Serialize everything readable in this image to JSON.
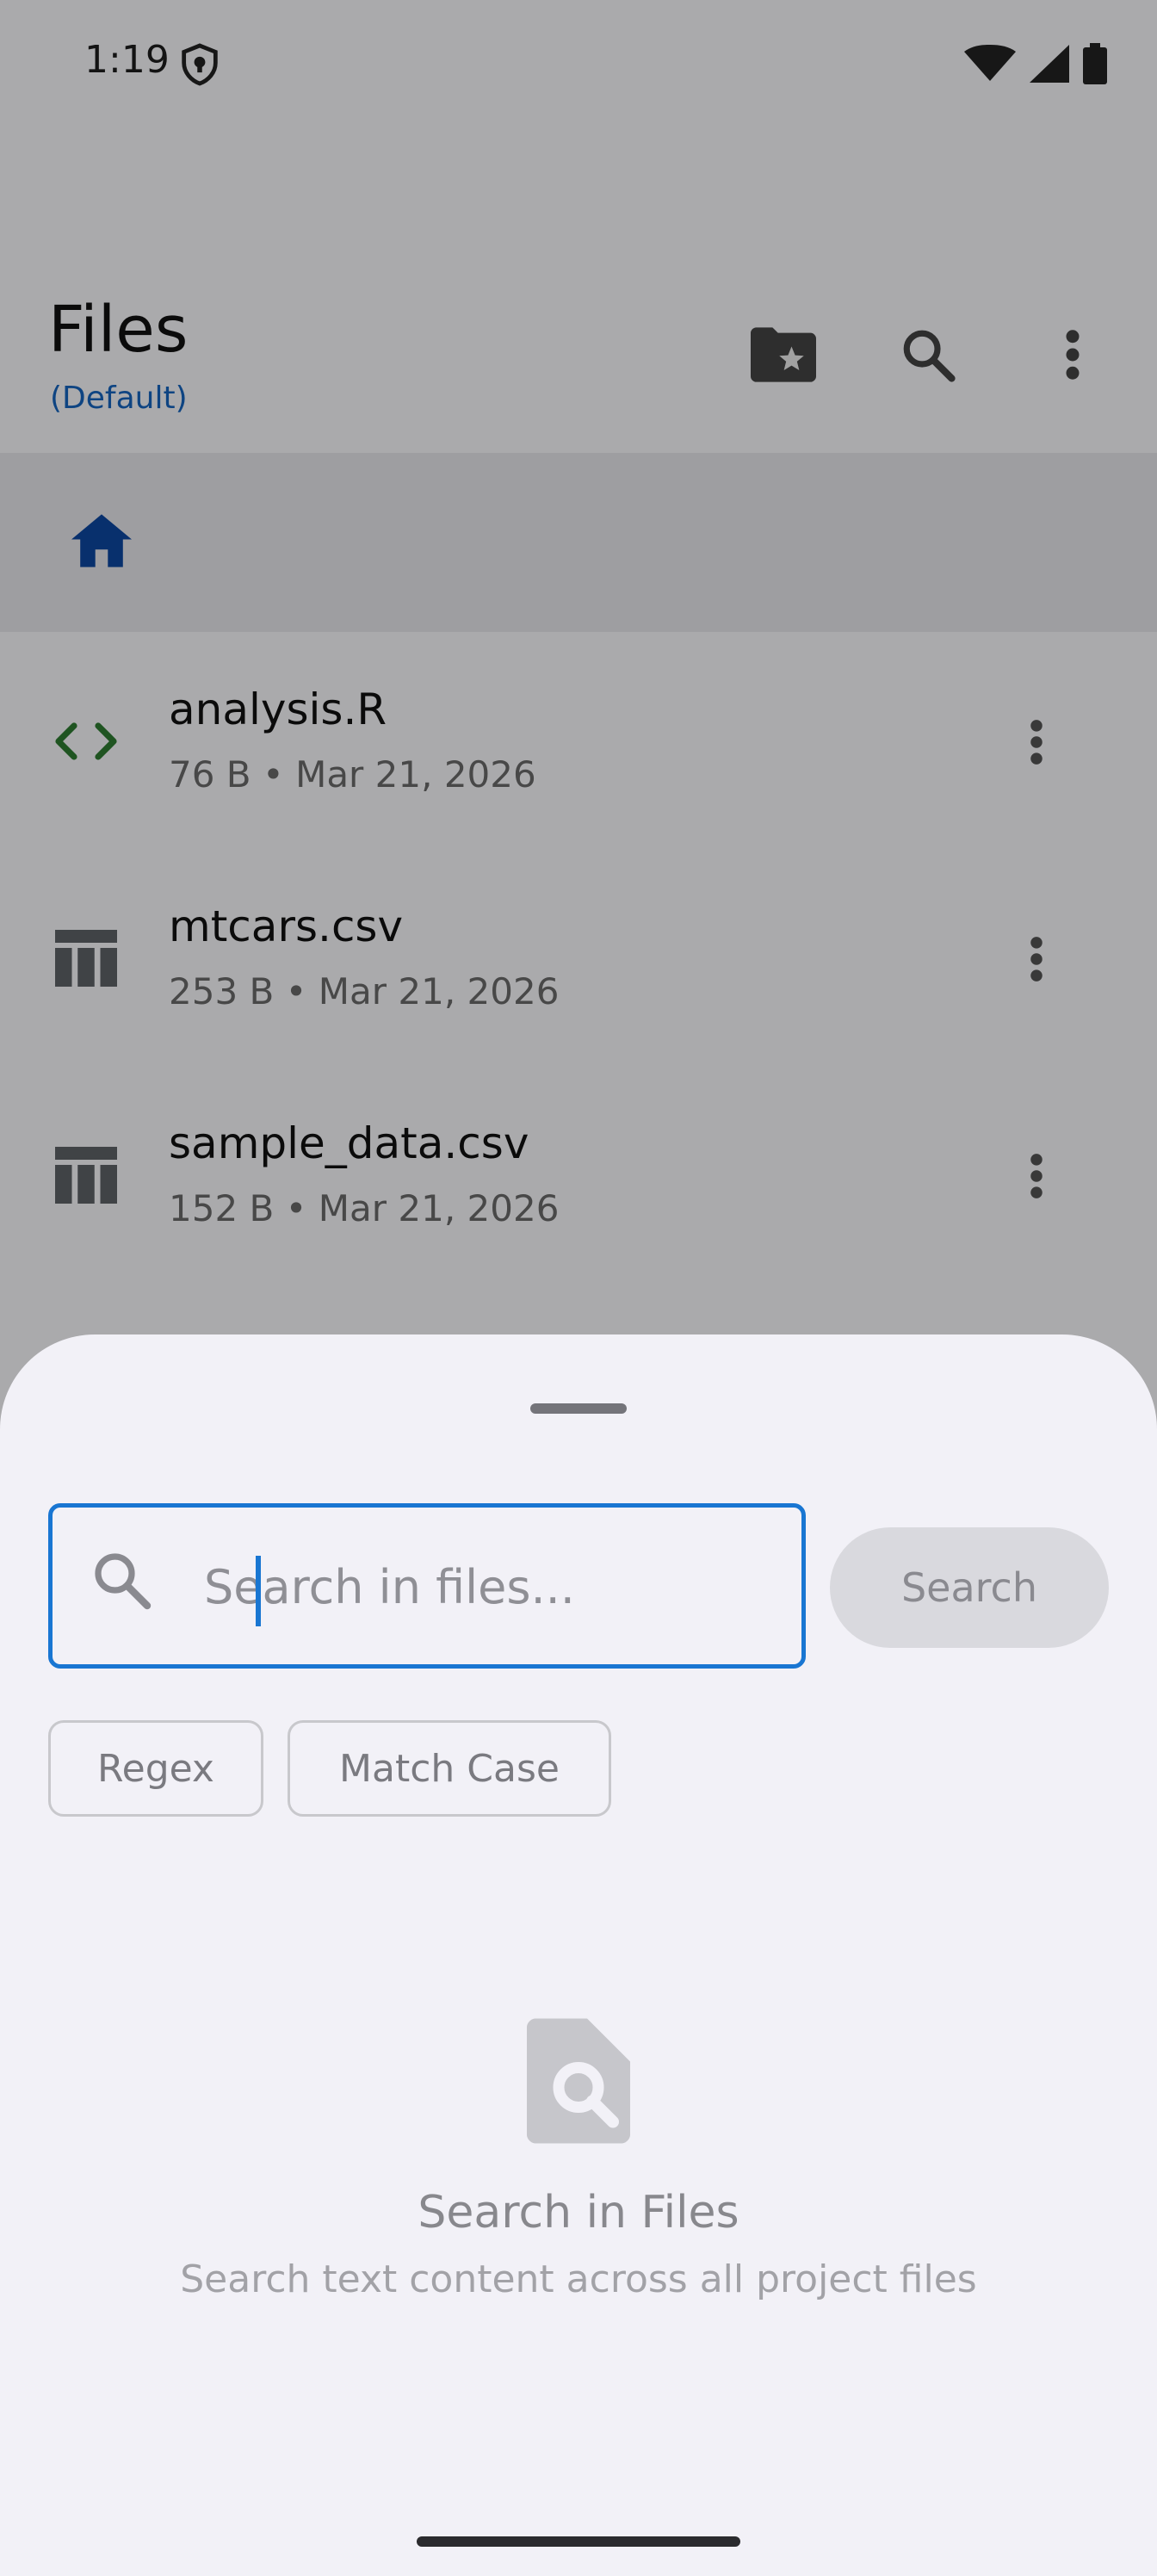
{
  "status_bar": {
    "time": "1:19"
  },
  "app_bar": {
    "title": "Files",
    "subtitle": "(Default)",
    "actions": [
      "folder-star-icon",
      "search-icon",
      "more-vert-icon"
    ]
  },
  "breadcrumb": {
    "home_icon": "home-icon"
  },
  "files": [
    {
      "name": "analysis.R",
      "meta": "76 B • Mar 21, 2026",
      "icon": "code-icon",
      "icon_color": "#2e7d32"
    },
    {
      "name": "mtcars.csv",
      "meta": "253 B • Mar 21, 2026",
      "icon": "table-icon",
      "icon_color": "#5f6368"
    },
    {
      "name": "sample_data.csv",
      "meta": "152 B • Mar 21, 2026",
      "icon": "table-icon",
      "icon_color": "#5f6368"
    }
  ],
  "sheet": {
    "search_placeholder": "Search in files...",
    "search_value": "",
    "search_button": "Search",
    "chips": [
      "Regex",
      "Match Case"
    ],
    "empty_title": "Search in Files",
    "empty_subtitle": "Search text content across all project files"
  },
  "colors": {
    "accent": "#1976d2",
    "subtitle": "#1565c0",
    "code_icon": "#2e7d32"
  }
}
